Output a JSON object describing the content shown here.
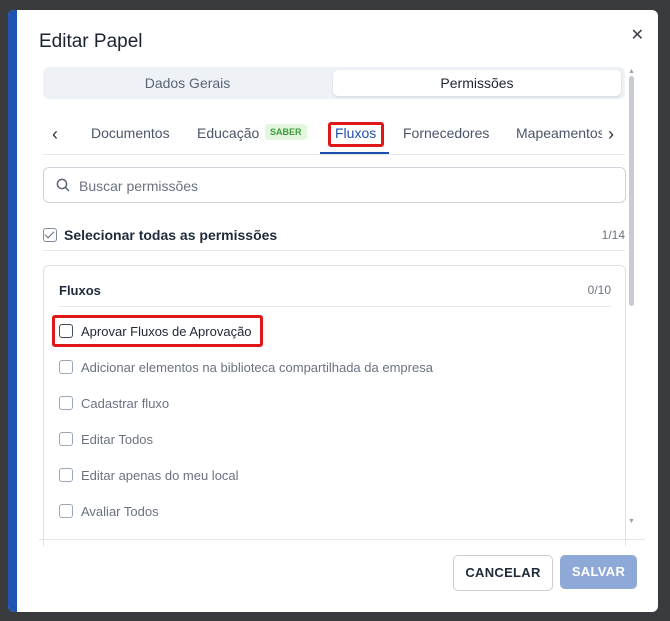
{
  "dialog": {
    "title": "Editar Papel",
    "close_icon": "close-icon"
  },
  "segmented": {
    "general_label": "Dados Gerais",
    "permissions_label": "Permissões",
    "selected": "Permissões"
  },
  "tabs": {
    "items": [
      "Documentos",
      "Educação",
      "Fluxos",
      "Fornecedores",
      "Mapeamentos"
    ],
    "active": "Fluxos",
    "badge": "SABER",
    "prev_icon": "chevron-left-icon",
    "next_icon": "chevron-right-icon"
  },
  "search": {
    "placeholder": "Buscar permissões",
    "value": ""
  },
  "select_all": {
    "label": "Selecionar todas as permissões",
    "count": "1/14",
    "checked": true
  },
  "group": {
    "title": "Fluxos",
    "count": "0/10",
    "items": [
      "Aprovar Fluxos de Aprovação",
      "Adicionar elementos na biblioteca compartilhada da empresa",
      "Cadastrar fluxo",
      "Editar Todos",
      "Editar apenas do meu local",
      "Avaliar Todos"
    ]
  },
  "buttons": {
    "cancel": "CANCELAR",
    "save": "SALVAR"
  },
  "colors": {
    "accent": "#1f53b4",
    "highlight": "#e01717",
    "save_disabled": "#8ea8d8"
  }
}
